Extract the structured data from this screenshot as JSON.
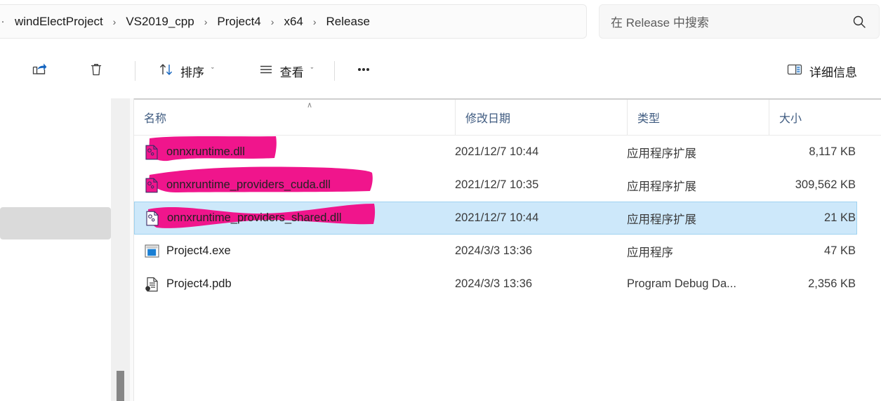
{
  "window": {
    "title": "Release"
  },
  "addressbar": {
    "overflow_glyph": "·",
    "crumbs": [
      {
        "label": "windElectProject"
      },
      {
        "label": "VS2019_cpp"
      },
      {
        "label": "Project4"
      },
      {
        "label": "x64"
      },
      {
        "label": "Release"
      }
    ],
    "separator": "›"
  },
  "search": {
    "placeholder": "在 Release 中搜索",
    "icon": "search-icon"
  },
  "toolbar": {
    "share": {
      "icon": "share-icon",
      "label": ""
    },
    "delete": {
      "icon": "trash-icon",
      "label": ""
    },
    "sort": {
      "icon": "sort-arrows-icon",
      "label": "排序",
      "chevron": "ˇ"
    },
    "view": {
      "icon": "view-lines-icon",
      "label": "查看",
      "chevron": "ˇ"
    },
    "more": {
      "icon": "ellipsis-icon",
      "label": "•••"
    },
    "details": {
      "icon": "details-pane-icon",
      "label": "详细信息"
    }
  },
  "columns": [
    {
      "key": "name",
      "label": "名称",
      "sorted": true,
      "sort_direction": "ascending",
      "sort_caret": "∧"
    },
    {
      "key": "date",
      "label": "修改日期"
    },
    {
      "key": "type",
      "label": "类型"
    },
    {
      "key": "size",
      "label": "大小"
    }
  ],
  "files": [
    {
      "name": "onnxruntime.dll",
      "date": "2021/12/7 10:44",
      "type": "应用程序扩展",
      "size": "8,117 KB",
      "icon": "dll-file-icon",
      "selected": false,
      "highlighted": true
    },
    {
      "name": "onnxruntime_providers_cuda.dll",
      "date": "2021/12/7 10:35",
      "type": "应用程序扩展",
      "size": "309,562 KB",
      "icon": "dll-file-icon",
      "selected": false,
      "highlighted": true
    },
    {
      "name": "onnxruntime_providers_shared.dll",
      "date": "2021/12/7 10:44",
      "type": "应用程序扩展",
      "size": "21 KB",
      "icon": "dll-file-icon",
      "selected": true,
      "highlighted": true
    },
    {
      "name": "Project4.exe",
      "date": "2024/3/3 13:36",
      "type": "应用程序",
      "size": "47 KB",
      "icon": "exe-file-icon",
      "selected": false,
      "highlighted": false
    },
    {
      "name": "Project4.pdb",
      "date": "2024/3/3 13:36",
      "type": "Program Debug Da...",
      "size": "2,356 KB",
      "icon": "pdb-file-icon",
      "selected": false,
      "highlighted": false
    }
  ],
  "colors": {
    "highlighter": "#f0158c",
    "selection_fill": "#cde8fa",
    "selection_border": "#9fd2f0",
    "accent": "#0b6cbf",
    "header_text": "#3f5b80",
    "scrollbar_thumb": "#868686"
  },
  "scrollbar": {
    "orientation": "vertical",
    "thumb_position": "bottom"
  }
}
